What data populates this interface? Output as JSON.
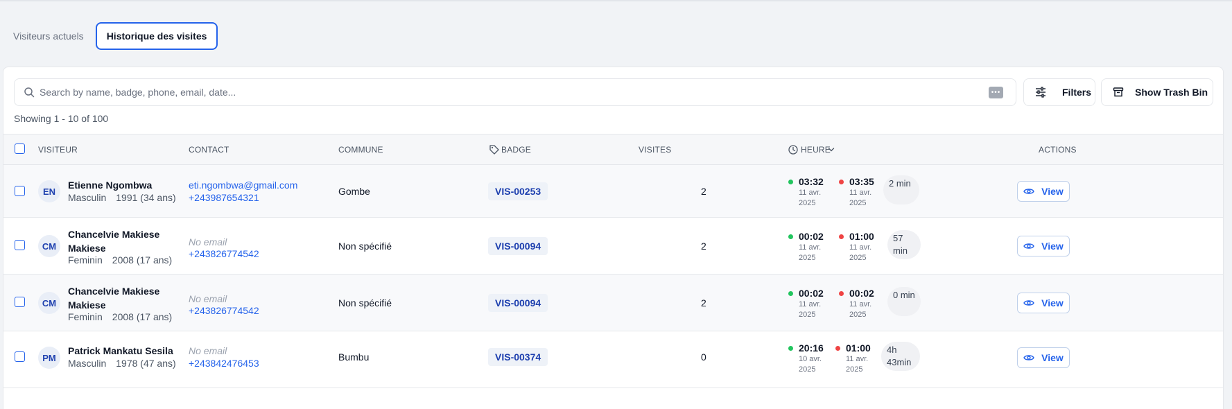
{
  "tabs": [
    {
      "label": "Visiteurs actuels",
      "active": false
    },
    {
      "label": "Historique des visites",
      "active": true
    }
  ],
  "search": {
    "placeholder": "Search by name, badge, phone, email, date..."
  },
  "toolbar": {
    "filters_label": "Filters",
    "trash_label": "Show Trash Bin"
  },
  "showing_text": "Showing 1 - 10 of 100",
  "columns": {
    "visitor": "VISITEUR",
    "contact": "CONTACT",
    "commune": "COMMUNE",
    "badge": "BADGE",
    "visits": "VISITES",
    "time": "HEURE",
    "actions": "ACTIONS"
  },
  "rows": [
    {
      "initials": "EN",
      "name": "Etienne Ngombwa",
      "gender": "Masculin",
      "birth": "1991 (34 ans)",
      "email": "eti.ngombwa@gmail.com",
      "phone": "+243987654321",
      "commune": "Gombe",
      "badge": "VIS-00253",
      "visits": "2",
      "in_time": "03:32",
      "in_date": "11 avr. 2025",
      "out_time": "03:35",
      "out_date": "11 avr. 2025",
      "duration": "2 min",
      "action": "View"
    },
    {
      "initials": "CM",
      "name": "Chancelvie Makiese Makiese",
      "gender": "Feminin",
      "birth": "2008 (17 ans)",
      "email": "No email",
      "phone": "+243826774542",
      "commune": "Non spécifié",
      "badge": "VIS-00094",
      "visits": "2",
      "in_time": "00:02",
      "in_date": "11 avr. 2025",
      "out_time": "01:00",
      "out_date": "11 avr. 2025",
      "duration": "57 min",
      "action": "View"
    },
    {
      "initials": "CM",
      "name": "Chancelvie Makiese Makiese",
      "gender": "Feminin",
      "birth": "2008 (17 ans)",
      "email": "No email",
      "phone": "+243826774542",
      "commune": "Non spécifié",
      "badge": "VIS-00094",
      "visits": "2",
      "in_time": "00:02",
      "in_date": "11 avr. 2025",
      "out_time": "00:02",
      "out_date": "11 avr. 2025",
      "duration": "0 min",
      "action": "View"
    },
    {
      "initials": "PM",
      "name": "Patrick Mankatu Sesila",
      "gender": "Masculin",
      "birth": "1978 (47 ans)",
      "email": "No email",
      "phone": "+243842476453",
      "commune": "Bumbu",
      "badge": "VIS-00374",
      "visits": "0",
      "in_time": "20:16",
      "in_date": "10 avr. 2025",
      "out_time": "01:00",
      "out_date": "11 avr. 2025",
      "duration": "4h 43min",
      "action": "View"
    }
  ]
}
